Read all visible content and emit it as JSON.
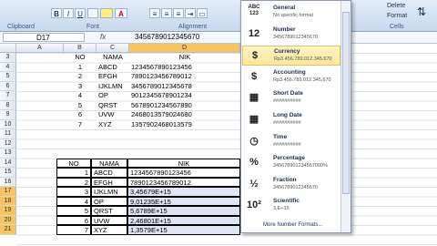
{
  "ribbon": {
    "bold": "B",
    "italic": "I",
    "underline": "U",
    "clipboard": "Clipboard",
    "font": "Font",
    "alignment": "Alignment",
    "cells": "Cells",
    "delete": "Delete",
    "format": "Format"
  },
  "formula_bar": {
    "name_box": "D17",
    "fx": "fx",
    "value": "3456789012345670"
  },
  "columns": [
    "A",
    "B",
    "C",
    "D"
  ],
  "rows": [
    "3",
    "4",
    "5",
    "6",
    "7",
    "8",
    "9",
    "10",
    "11",
    "12",
    "13",
    "14",
    "15",
    "16",
    "17",
    "18",
    "19",
    "20",
    "21"
  ],
  "table1": {
    "headers": [
      "NO",
      "NAMA",
      "NIK"
    ],
    "rows": [
      [
        "1",
        "ABCD",
        "1234567890123456"
      ],
      [
        "2",
        "EFGH",
        "7890123456789012"
      ],
      [
        "3",
        "IJKLMN",
        "3456789012345678"
      ],
      [
        "4",
        "OP",
        "9012345678901234"
      ],
      [
        "5",
        "QRST",
        "5678901234567890"
      ],
      [
        "6",
        "UVW",
        "2468013579024680"
      ],
      [
        "7",
        "XYZ",
        "1357902468013579"
      ]
    ]
  },
  "table2": {
    "headers": [
      "NO",
      "NAMA",
      "NIK"
    ],
    "rows": [
      [
        "1",
        "ABCD",
        "1234567890123456"
      ],
      [
        "2",
        "EFGH",
        "7890123456789012"
      ],
      [
        "3",
        "IJKLMN",
        "3,45679E+15"
      ],
      [
        "4",
        "OP",
        "9,01235E+15"
      ],
      [
        "5",
        "QRST",
        "5,6789E+15"
      ],
      [
        "6",
        "UVW",
        "2,46801E+15"
      ],
      [
        "7",
        "XYZ",
        "1,3579E+15"
      ]
    ]
  },
  "number_formats": [
    {
      "icon": "ABC\n123",
      "name": "General",
      "sample": "No specific format"
    },
    {
      "icon": "12",
      "name": "Number",
      "sample": "3456789012345670"
    },
    {
      "icon": "$",
      "name": "Currency",
      "sample": "Rp3.456.789.012.345.670"
    },
    {
      "icon": "$",
      "name": "Accounting",
      "sample": "Rp3.456.789.012.345.670"
    },
    {
      "icon": "▦",
      "name": "Short Date",
      "sample": "##########"
    },
    {
      "icon": "▦",
      "name": "Long Date",
      "sample": "##########"
    },
    {
      "icon": "◷",
      "name": "Time",
      "sample": "##########"
    },
    {
      "icon": "%",
      "name": "Percentage",
      "sample": "345678901234567000%"
    },
    {
      "icon": "½",
      "name": "Fraction",
      "sample": "3456789012345670"
    },
    {
      "icon": "10²",
      "name": "Scientific",
      "sample": "3,E+15"
    }
  ],
  "more_formats": "More Number Formats..."
}
